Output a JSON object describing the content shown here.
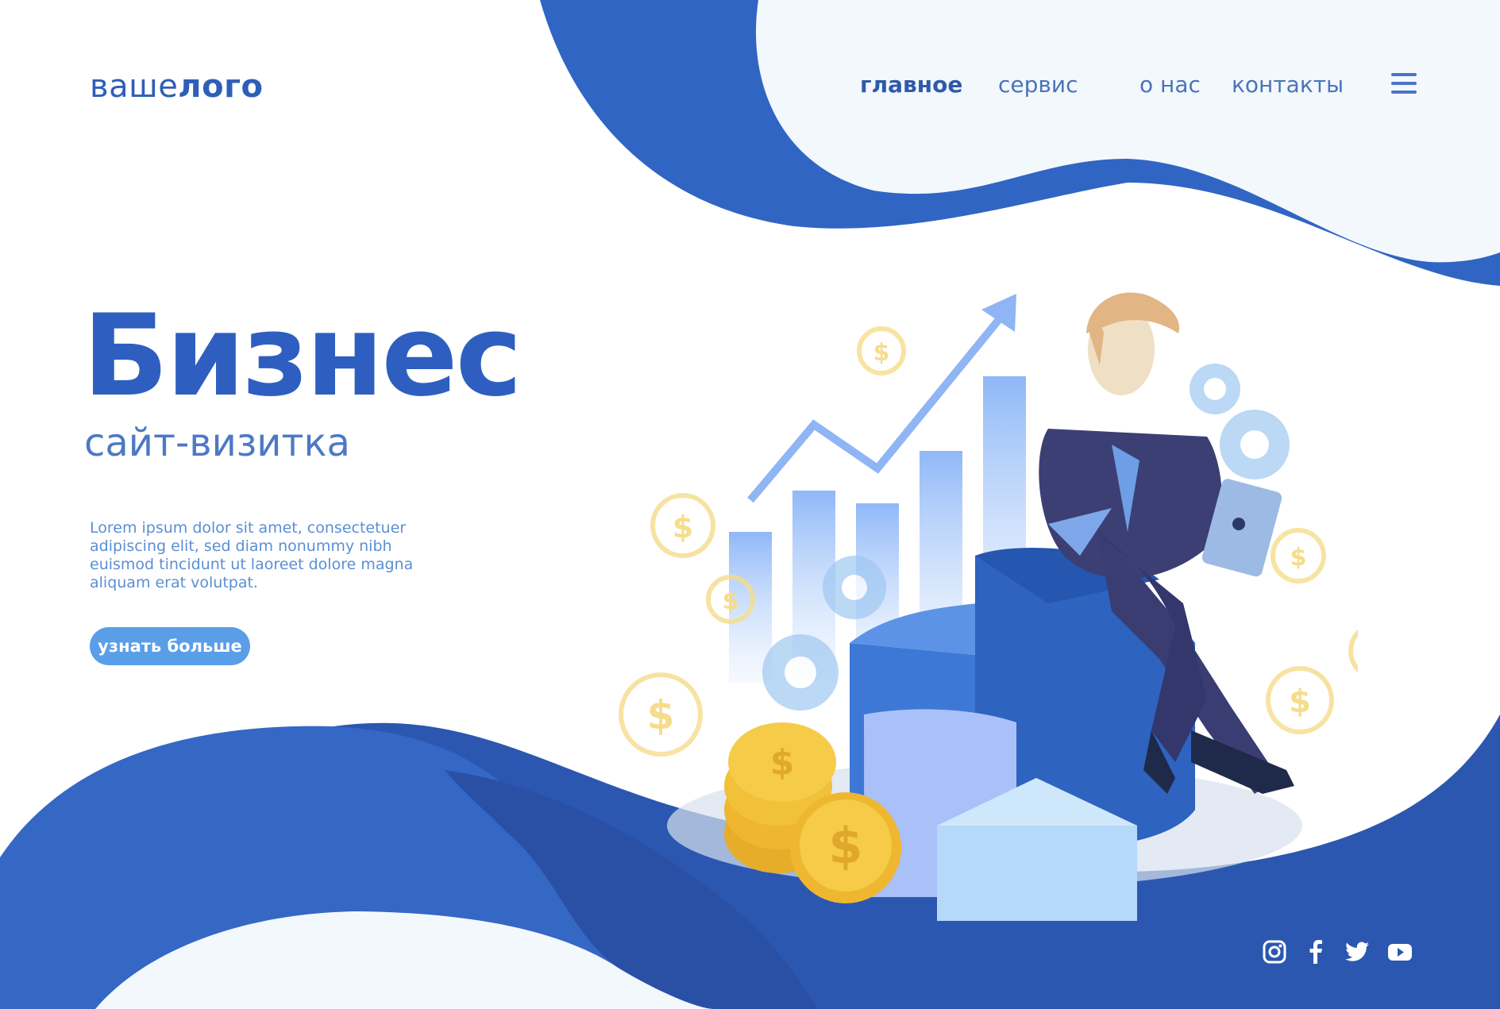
{
  "header": {
    "logo_light": "ваше",
    "logo_bold": "лого",
    "nav": [
      "главное",
      "сервис",
      "о нас",
      "контакты"
    ],
    "active_nav": "главное",
    "menu_icon": "menu-icon"
  },
  "hero": {
    "title": "Бизнес",
    "subtitle": "сайт-визитка",
    "text": "Lorem ipsum dolor sit amet, consectetuer adipiscing elit, sed diam nonummy nibh euismod tincidunt ut laoreet dolore magna aliquam erat volutpat.",
    "button": "узнать больше"
  },
  "socials": [
    "instagram-icon",
    "facebook-icon",
    "twitter-icon",
    "youtube-icon"
  ],
  "colors": {
    "primary": "#3065c3",
    "dark_blue": "#2a52a8",
    "light_bg": "#f3f8fd",
    "accent": "#5a9ee8",
    "gold": "#f2c13a"
  }
}
